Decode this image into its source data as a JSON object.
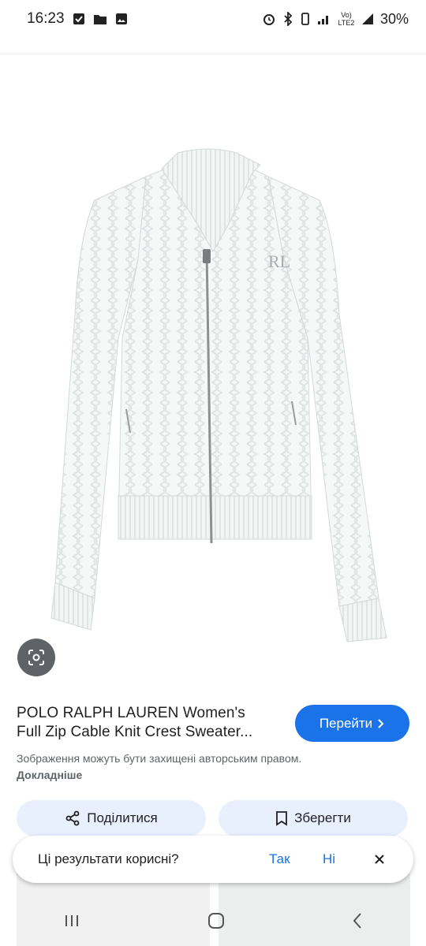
{
  "status_bar": {
    "time": "16:23",
    "signal_label": "Vo) LTE2",
    "battery": "30%"
  },
  "result": {
    "title_line1": "POLO RALPH LAUREN Women's",
    "title_line2": "Full Zip Cable Knit Crest Sweater...",
    "visit_label": "Перейти",
    "notice_text": "Зображення можуть бути захищені авторським правом. ",
    "notice_link": "Докладніше"
  },
  "actions": {
    "share_label": "Поділитися",
    "save_label": "Зберегти"
  },
  "feedback": {
    "question": "Ці результати корисні?",
    "yes_label": "Так",
    "no_label": "Ні"
  },
  "colors": {
    "accent": "#1a73e8",
    "chip_bg": "#e8f0fe",
    "lens_bg": "#5f6368"
  }
}
